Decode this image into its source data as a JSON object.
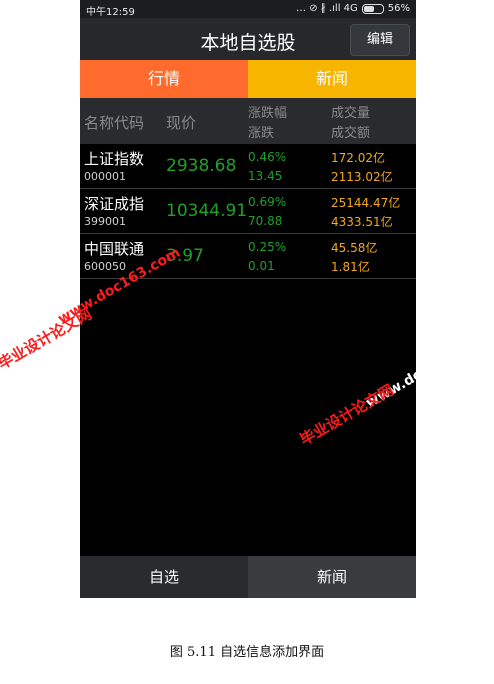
{
  "status": {
    "time": "中午12:59",
    "icons": "… ⊘ ∦ .ıll 4G",
    "battery": "56%"
  },
  "title": "本地自选股",
  "edit_label": "编辑",
  "top_tabs": [
    {
      "label": "行情"
    },
    {
      "label": "新闻"
    }
  ],
  "header": {
    "name_code": "名称代码",
    "price": "现价",
    "pct": "涨跌幅",
    "change": "涨跌",
    "volume": "成交量",
    "amount": "成交额"
  },
  "rows": [
    {
      "name": "上证指数",
      "code": "000001",
      "price": "2938.68",
      "pct": "0.46%",
      "change": "13.45",
      "volume": "172.02亿",
      "amount": "2113.02亿"
    },
    {
      "name": "深证成指",
      "code": "399001",
      "price": "10344.91",
      "pct": "0.69%",
      "change": "70.88",
      "volume": "25144.47亿",
      "amount": "4333.51亿"
    },
    {
      "name": "中国联通",
      "code": "600050",
      "price": "3.97",
      "pct": "0.25%",
      "change": "0.01",
      "volume": "45.58亿",
      "amount": "1.81亿"
    }
  ],
  "bottom_tabs": [
    {
      "label": "自选"
    },
    {
      "label": "新闻"
    }
  ],
  "watermark": {
    "site": "www.doc163.com",
    "text": "毕业设计论文网"
  },
  "caption": "图 5.11 自选信息添加界面",
  "colors": {
    "accent_orange": "#ff6b2c",
    "accent_yellow": "#f7b500",
    "up_green": "#1fa12a",
    "volume_orange": "#f2a81a"
  }
}
